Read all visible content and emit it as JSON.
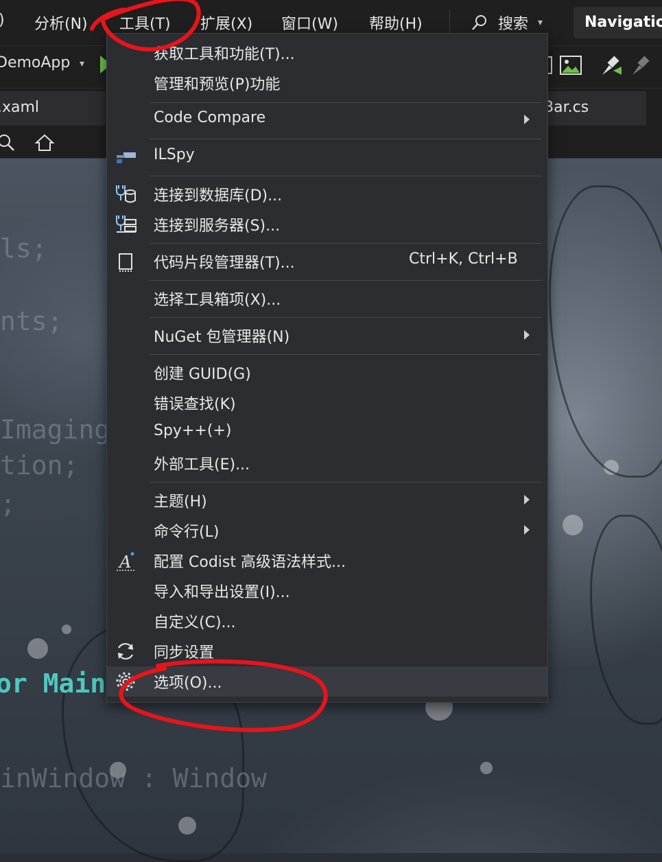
{
  "menubar": {
    "partial_left": ")",
    "items": [
      "分析(N)",
      "工具(T)",
      "扩展(X)",
      "窗口(W)",
      "帮助(H)"
    ],
    "search_label": "搜索",
    "search_icon": "search-icon",
    "nav_box_label": "Navigatio"
  },
  "toolbar": {
    "project": "DemoApp",
    "icons": [
      "run-icon",
      "image-icon",
      "build-icon",
      "rebuild-icon"
    ]
  },
  "tabs": {
    "left_tab": ".xaml",
    "right_tab": "Bar.cs"
  },
  "nav_row": {
    "icons": [
      "search-icon",
      "home-icon"
    ]
  },
  "code_lines": {
    "l1": "ls;",
    "l2": "nts;",
    "l3": "Imaging",
    "l4": "tion;",
    "l5": ";",
    "l6_kw": "or Main",
    "l7": "inWindow : Window"
  },
  "dropdown": {
    "items": [
      {
        "label": "获取工具和功能(T)..."
      },
      {
        "label": "管理和预览(P)功能"
      },
      {
        "label": "Code Compare",
        "submenu": true
      },
      {
        "label": "ILSpy",
        "icon": "ilspy-icon"
      },
      {
        "label": "连接到数据库(D)...",
        "icon": "database-connect-icon"
      },
      {
        "label": "连接到服务器(S)...",
        "icon": "server-connect-icon"
      },
      {
        "label": "代码片段管理器(T)...",
        "shortcut": "Ctrl+K, Ctrl+B",
        "icon": "snippet-icon"
      },
      {
        "label": "选择工具箱项(X)..."
      },
      {
        "label": "NuGet 包管理器(N)",
        "submenu": true
      },
      {
        "label": "创建 GUID(G)"
      },
      {
        "label": "错误查找(K)"
      },
      {
        "label": "Spy++(+)"
      },
      {
        "label": "外部工具(E)..."
      },
      {
        "label": "主题(H)",
        "submenu": true
      },
      {
        "label": "命令行(L)",
        "submenu": true
      },
      {
        "label": "配置 Codist 高级语法样式...",
        "icon": "text-style-icon"
      },
      {
        "label": "导入和导出设置(I)..."
      },
      {
        "label": "自定义(C)..."
      },
      {
        "label": "同步设置",
        "icon": "sync-icon"
      },
      {
        "label": "选项(O)...",
        "icon": "gear-icon",
        "highlighted": true
      }
    ]
  },
  "colors": {
    "annotation_red": "#e8141c",
    "menu_bg": "#2b2d31",
    "keyword_teal": "#4ec9c0",
    "run_green": "#6cc04a"
  }
}
